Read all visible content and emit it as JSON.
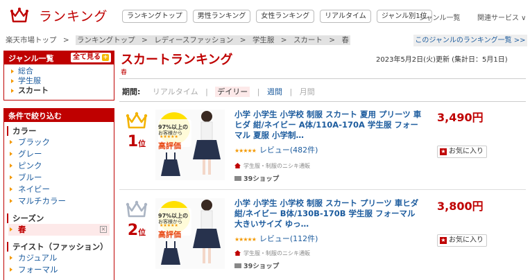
{
  "header": {
    "logo_text": "ランキング",
    "nav": [
      "ランキングトップ",
      "男性ランキング",
      "女性ランキング",
      "リアルタイム",
      "ジャンル別1位"
    ],
    "genre_list": "ジャンル一覧",
    "related": "関連サービス ∨"
  },
  "breadcrumb": {
    "items": [
      "楽天市場トップ",
      "ランキングトップ",
      "レディースファッション",
      "学生服",
      "スカート",
      "春"
    ],
    "sep": ">"
  },
  "genre_ranking_link": "このジャンルのランキング一覧 >>",
  "sidebar": {
    "genre_title": "ジャンル一覧",
    "see_all": "全て見る",
    "see_all_icon": "+",
    "genres": [
      "総合",
      "学生服",
      "スカート"
    ],
    "filter_title": "条件で絞り込む",
    "color_title": "カラー",
    "colors": [
      "ブラック",
      "グレー",
      "ピンク",
      "ブルー",
      "ネイビー",
      "マルチカラー"
    ],
    "season_title": "シーズン",
    "season_selected": "春",
    "season_remove": "×",
    "taste_title": "テイスト（ファッション）",
    "tastes": [
      "カジュアル",
      "フォーマル"
    ]
  },
  "main": {
    "title": "スカートランキング",
    "subtitle": "春",
    "updated": "2023年5月2日(火)更新 (集計日：5月1日)",
    "period_label": "期間:",
    "periods": [
      "リアルタイム",
      "デイリー",
      "週間",
      "月間"
    ],
    "period_sep": "|"
  },
  "items": [
    {
      "rank": "1",
      "rank_suffix": "位",
      "crown_color": "#f3b200",
      "title": "小学 小学生 小学校 制服 スカート 夏用 プリーツ 車ヒダ 紺/ネイビー A体/110A-170A 学生服 フォーマル 夏服 小学制…",
      "review": "レビュー(482件)",
      "stars": "★★★★★",
      "shop": "学生服・制服のニシキ通販",
      "ship": "39ショップ",
      "price": "3,490円",
      "fav": "お気に入り",
      "thumb_lines": [
        "97%以上の",
        "お客様から",
        "★★★★★",
        "高評価"
      ]
    },
    {
      "rank": "2",
      "rank_suffix": "位",
      "crown_color": "#aab4c3",
      "title": "小学 小学生 小学校 制服 スカート プリーツ 車ヒダ 紺/ネイビー B体/130B-170B 学生服 フォーマル 大きいサイズ ゆっ…",
      "review": "レビュー(112件)",
      "stars": "★★★★★",
      "shop": "学生服・制服のニシキ通販",
      "ship": "39ショップ",
      "price": "3,800円",
      "fav": "お気に入り",
      "thumb_lines": [
        "97%以上の",
        "お客様から",
        "★★★★★",
        "高評価"
      ]
    }
  ],
  "colors": {
    "brand": "#bf0000",
    "link": "#1d5c9e",
    "accent": "#f39800"
  }
}
